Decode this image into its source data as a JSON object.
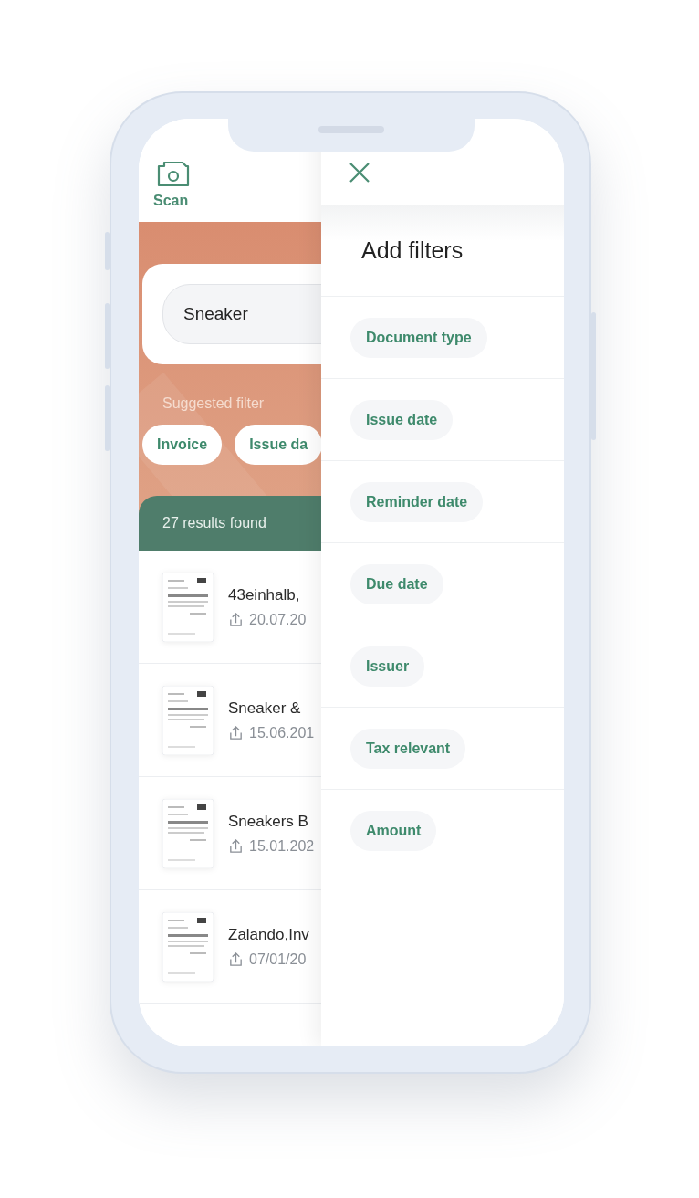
{
  "header": {
    "scan_label": "Scan"
  },
  "search": {
    "value": "Sneaker"
  },
  "suggested": {
    "label": "Suggested filter",
    "chips": [
      "Invoice",
      "Issue da"
    ]
  },
  "results": {
    "label": "27 results found"
  },
  "documents": [
    {
      "title": "43einhalb,",
      "date": "20.07.20"
    },
    {
      "title": "Sneaker &",
      "date": "15.06.201"
    },
    {
      "title": "Sneakers B",
      "date": "15.01.202"
    },
    {
      "title": "Zalando,Inv",
      "date": "07/01/20"
    }
  ],
  "drawer": {
    "title": "Add filters",
    "filters": [
      "Document type",
      "Issue date",
      "Reminder date",
      "Due date",
      "Issuer",
      "Tax relevant",
      "Amount"
    ]
  }
}
